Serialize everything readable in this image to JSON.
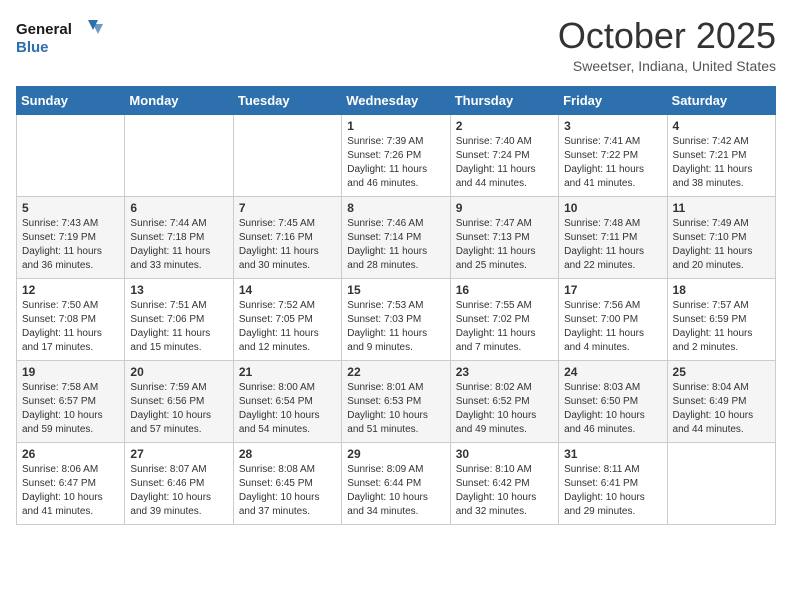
{
  "header": {
    "logo_line1": "General",
    "logo_line2": "Blue",
    "month": "October 2025",
    "location": "Sweetser, Indiana, United States"
  },
  "days_of_week": [
    "Sunday",
    "Monday",
    "Tuesday",
    "Wednesday",
    "Thursday",
    "Friday",
    "Saturday"
  ],
  "weeks": [
    [
      {
        "day": "",
        "info": ""
      },
      {
        "day": "",
        "info": ""
      },
      {
        "day": "",
        "info": ""
      },
      {
        "day": "1",
        "info": "Sunrise: 7:39 AM\nSunset: 7:26 PM\nDaylight: 11 hours and 46 minutes."
      },
      {
        "day": "2",
        "info": "Sunrise: 7:40 AM\nSunset: 7:24 PM\nDaylight: 11 hours and 44 minutes."
      },
      {
        "day": "3",
        "info": "Sunrise: 7:41 AM\nSunset: 7:22 PM\nDaylight: 11 hours and 41 minutes."
      },
      {
        "day": "4",
        "info": "Sunrise: 7:42 AM\nSunset: 7:21 PM\nDaylight: 11 hours and 38 minutes."
      }
    ],
    [
      {
        "day": "5",
        "info": "Sunrise: 7:43 AM\nSunset: 7:19 PM\nDaylight: 11 hours and 36 minutes."
      },
      {
        "day": "6",
        "info": "Sunrise: 7:44 AM\nSunset: 7:18 PM\nDaylight: 11 hours and 33 minutes."
      },
      {
        "day": "7",
        "info": "Sunrise: 7:45 AM\nSunset: 7:16 PM\nDaylight: 11 hours and 30 minutes."
      },
      {
        "day": "8",
        "info": "Sunrise: 7:46 AM\nSunset: 7:14 PM\nDaylight: 11 hours and 28 minutes."
      },
      {
        "day": "9",
        "info": "Sunrise: 7:47 AM\nSunset: 7:13 PM\nDaylight: 11 hours and 25 minutes."
      },
      {
        "day": "10",
        "info": "Sunrise: 7:48 AM\nSunset: 7:11 PM\nDaylight: 11 hours and 22 minutes."
      },
      {
        "day": "11",
        "info": "Sunrise: 7:49 AM\nSunset: 7:10 PM\nDaylight: 11 hours and 20 minutes."
      }
    ],
    [
      {
        "day": "12",
        "info": "Sunrise: 7:50 AM\nSunset: 7:08 PM\nDaylight: 11 hours and 17 minutes."
      },
      {
        "day": "13",
        "info": "Sunrise: 7:51 AM\nSunset: 7:06 PM\nDaylight: 11 hours and 15 minutes."
      },
      {
        "day": "14",
        "info": "Sunrise: 7:52 AM\nSunset: 7:05 PM\nDaylight: 11 hours and 12 minutes."
      },
      {
        "day": "15",
        "info": "Sunrise: 7:53 AM\nSunset: 7:03 PM\nDaylight: 11 hours and 9 minutes."
      },
      {
        "day": "16",
        "info": "Sunrise: 7:55 AM\nSunset: 7:02 PM\nDaylight: 11 hours and 7 minutes."
      },
      {
        "day": "17",
        "info": "Sunrise: 7:56 AM\nSunset: 7:00 PM\nDaylight: 11 hours and 4 minutes."
      },
      {
        "day": "18",
        "info": "Sunrise: 7:57 AM\nSunset: 6:59 PM\nDaylight: 11 hours and 2 minutes."
      }
    ],
    [
      {
        "day": "19",
        "info": "Sunrise: 7:58 AM\nSunset: 6:57 PM\nDaylight: 10 hours and 59 minutes."
      },
      {
        "day": "20",
        "info": "Sunrise: 7:59 AM\nSunset: 6:56 PM\nDaylight: 10 hours and 57 minutes."
      },
      {
        "day": "21",
        "info": "Sunrise: 8:00 AM\nSunset: 6:54 PM\nDaylight: 10 hours and 54 minutes."
      },
      {
        "day": "22",
        "info": "Sunrise: 8:01 AM\nSunset: 6:53 PM\nDaylight: 10 hours and 51 minutes."
      },
      {
        "day": "23",
        "info": "Sunrise: 8:02 AM\nSunset: 6:52 PM\nDaylight: 10 hours and 49 minutes."
      },
      {
        "day": "24",
        "info": "Sunrise: 8:03 AM\nSunset: 6:50 PM\nDaylight: 10 hours and 46 minutes."
      },
      {
        "day": "25",
        "info": "Sunrise: 8:04 AM\nSunset: 6:49 PM\nDaylight: 10 hours and 44 minutes."
      }
    ],
    [
      {
        "day": "26",
        "info": "Sunrise: 8:06 AM\nSunset: 6:47 PM\nDaylight: 10 hours and 41 minutes."
      },
      {
        "day": "27",
        "info": "Sunrise: 8:07 AM\nSunset: 6:46 PM\nDaylight: 10 hours and 39 minutes."
      },
      {
        "day": "28",
        "info": "Sunrise: 8:08 AM\nSunset: 6:45 PM\nDaylight: 10 hours and 37 minutes."
      },
      {
        "day": "29",
        "info": "Sunrise: 8:09 AM\nSunset: 6:44 PM\nDaylight: 10 hours and 34 minutes."
      },
      {
        "day": "30",
        "info": "Sunrise: 8:10 AM\nSunset: 6:42 PM\nDaylight: 10 hours and 32 minutes."
      },
      {
        "day": "31",
        "info": "Sunrise: 8:11 AM\nSunset: 6:41 PM\nDaylight: 10 hours and 29 minutes."
      },
      {
        "day": "",
        "info": ""
      }
    ]
  ]
}
